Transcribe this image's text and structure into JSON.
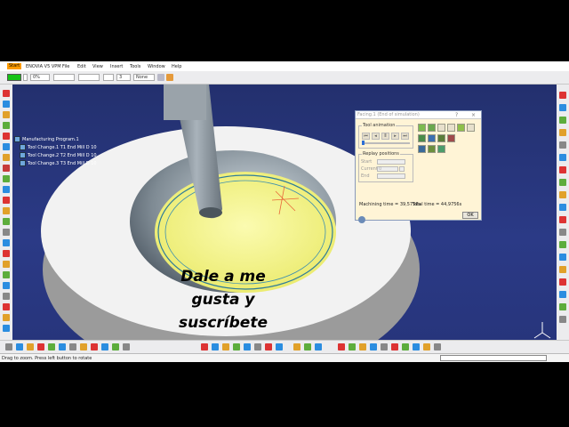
{
  "menu": {
    "items": [
      "Start",
      "ENOVIA V5 VPM",
      "File",
      "Edit",
      "View",
      "Insert",
      "Tools",
      "Window",
      "Help"
    ]
  },
  "toolbar": {
    "color_swatch": "#16c316",
    "opacity_value": "0%",
    "layer_value": "3",
    "filter_value": "None"
  },
  "tree": {
    "root": "Manufacturing Program.1",
    "items": [
      "Tool Change.1  T1 End Mill D 10",
      "Tool Change.2  T2 End Mill D 10",
      "Tool Change.3  T3 End Mill D 10"
    ]
  },
  "dialog": {
    "title": "Facing.1 (End of simulation)",
    "help_btn": "?",
    "close_btn": "×",
    "tool_animation_label": "Tool animation",
    "replay_label": "Replay positions",
    "start_label": "Start",
    "current_label": "Current",
    "current_value": "0",
    "end_label": "End",
    "machining_time": "Machining time = 39,5756s",
    "total_time": "Total time = 44,9756s",
    "ok_label": "OK"
  },
  "status": {
    "text": "Drag to zoom. Press left button to rotate"
  },
  "caption": {
    "line1": "Dale a me",
    "line2": "gusta y",
    "line3": "suscríbete"
  }
}
